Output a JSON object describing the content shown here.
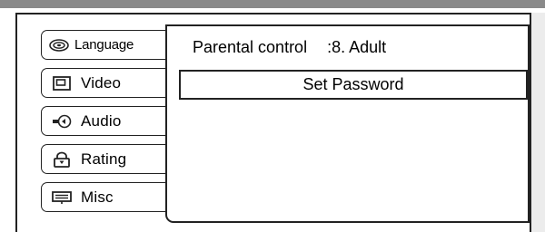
{
  "tabs": [
    {
      "id": "language",
      "label": "Language",
      "icon": "disc-icon"
    },
    {
      "id": "video",
      "label": "Video",
      "icon": "screen-icon"
    },
    {
      "id": "audio",
      "label": "Audio",
      "icon": "speaker-icon"
    },
    {
      "id": "rating",
      "label": "Rating",
      "icon": "lock-icon"
    },
    {
      "id": "misc",
      "label": "Misc",
      "icon": "keyboard-icon"
    }
  ],
  "panel": {
    "parental_label": "Parental control",
    "parental_value": ":8. Adult",
    "set_password_label": "Set Password"
  }
}
